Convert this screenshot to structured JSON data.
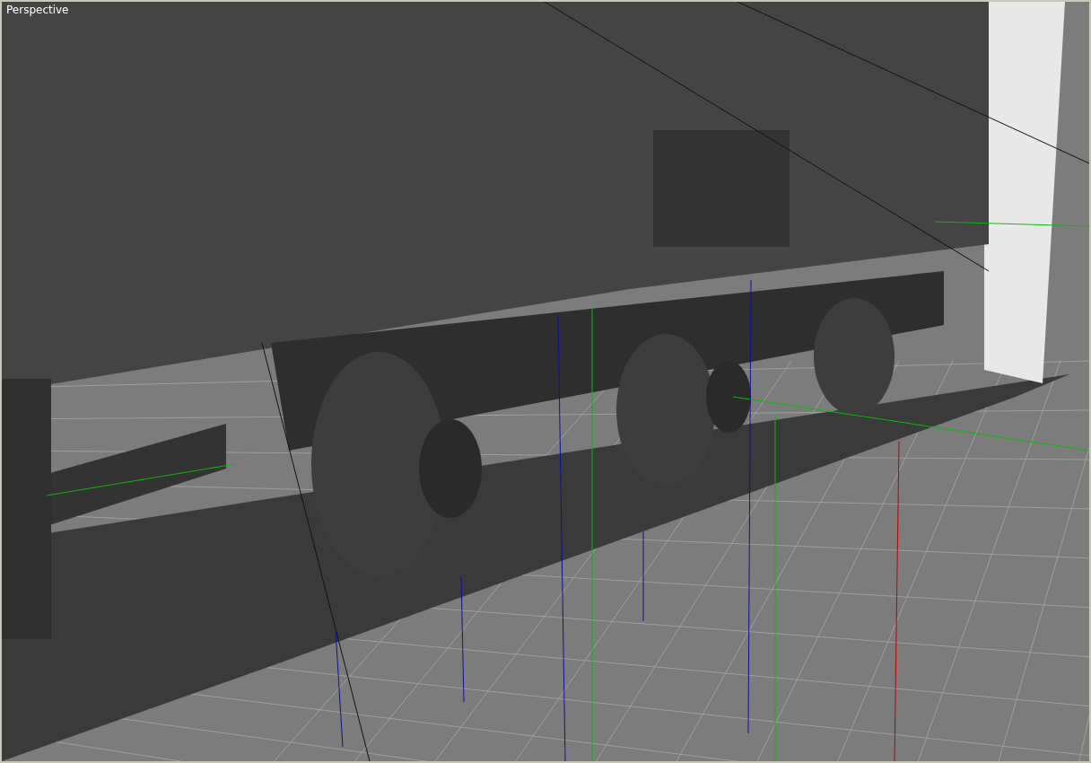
{
  "viewport": {
    "label": "Perspective"
  }
}
